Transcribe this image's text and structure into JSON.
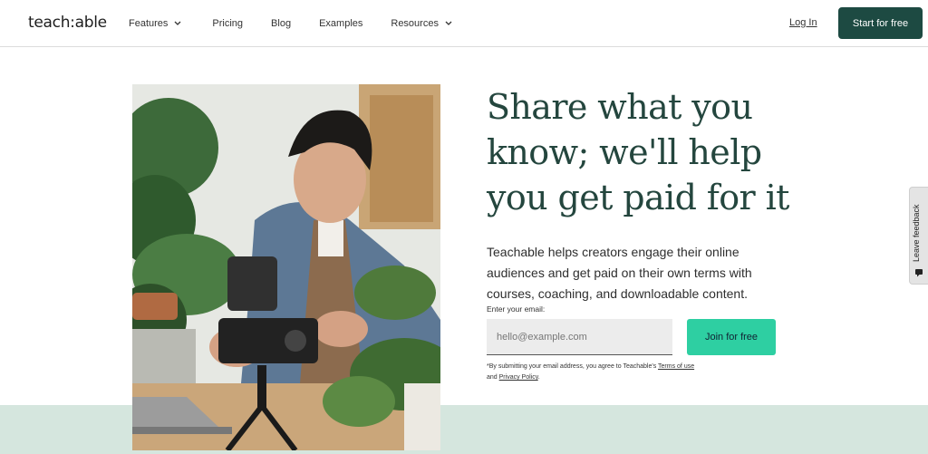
{
  "header": {
    "logo": "teach:able",
    "nav": [
      {
        "label": "Features",
        "has_dropdown": true
      },
      {
        "label": "Pricing",
        "has_dropdown": false
      },
      {
        "label": "Blog",
        "has_dropdown": false
      },
      {
        "label": "Examples",
        "has_dropdown": false
      },
      {
        "label": "Resources",
        "has_dropdown": true
      }
    ],
    "login_label": "Log In",
    "cta_label": "Start for free"
  },
  "hero": {
    "headline": "Share what you know; we'll help you get paid for it",
    "subtext": "Teachable helps creators engage their online audiences and get paid on their own terms with courses, coaching, and downloadable content.",
    "email_label": "Enter your email:",
    "email_placeholder": "hello@example.com",
    "join_label": "Join for free",
    "disclaimer_prefix": "*By submitting your email address, you agree to Teachable's",
    "terms_label": "Terms of use",
    "and_text": "and",
    "privacy_label": "Privacy Policy",
    "period": "."
  },
  "feedback": {
    "label": "Leave feedback"
  },
  "colors": {
    "brand_dark": "#1d4a42",
    "accent": "#2ecfa2",
    "band": "#d5e6de",
    "headline": "#24463e"
  },
  "icons": [
    "chevron-down-icon",
    "feedback-icon"
  ]
}
